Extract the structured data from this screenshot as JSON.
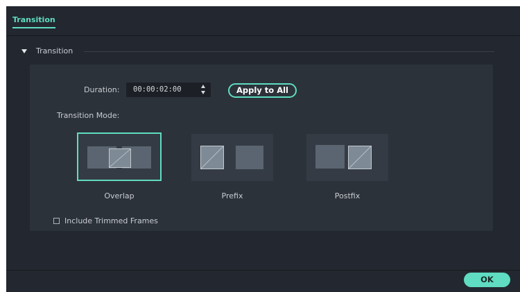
{
  "tabs": {
    "active_label": "Transition"
  },
  "section": {
    "title": "Transition"
  },
  "duration": {
    "label": "Duration:",
    "value": "00:00:02:00"
  },
  "apply_all": {
    "label": "Apply to All"
  },
  "mode": {
    "label": "Transition Mode:",
    "options": [
      {
        "label": "Overlap",
        "selected": true
      },
      {
        "label": "Prefix",
        "selected": false
      },
      {
        "label": "Postfix",
        "selected": false
      }
    ]
  },
  "include_trimmed": {
    "label": "Include Trimmed Frames",
    "checked": false
  },
  "footer": {
    "ok_label": "OK"
  },
  "colors": {
    "accent": "#5fdcc1",
    "background": "#232830",
    "panel": "#2c323a"
  },
  "icons": {
    "section_toggle": "triangle-down-icon",
    "spinner": "spinner-arrows-icon"
  }
}
